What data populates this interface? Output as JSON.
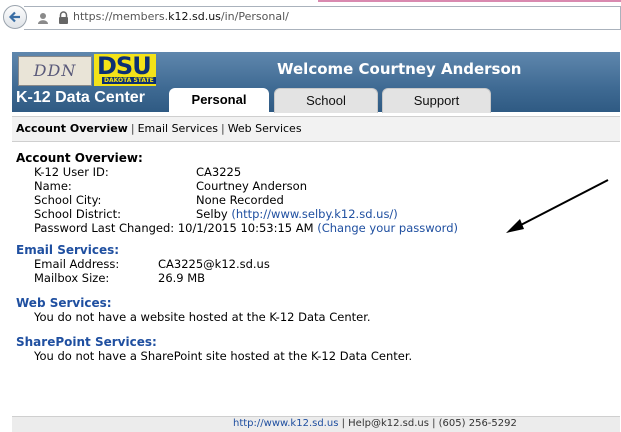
{
  "browser": {
    "url_prefix": "https://members.",
    "url_domain": "k12.sd.us",
    "url_path": "/in/Personal/"
  },
  "header": {
    "logo_ddn": "DDN",
    "logo_dsu": "DSU",
    "logo_dsu_sub": "DAKOTA STATE",
    "brand": "K-12 Data Center",
    "welcome": "Welcome Courtney Anderson",
    "tabs": [
      {
        "label": "Personal",
        "active": true
      },
      {
        "label": "School",
        "active": false
      },
      {
        "label": "Support",
        "active": false
      }
    ]
  },
  "subnav": {
    "current": "Account Overview",
    "links": [
      "Email Services",
      "Web Services"
    ],
    "separator": "|"
  },
  "account": {
    "title": "Account Overview:",
    "rows": [
      {
        "label": "K-12 User ID:",
        "value": "CA3225"
      },
      {
        "label": "Name:",
        "value": "Courtney Anderson"
      },
      {
        "label": "School City:",
        "value": "None Recorded"
      },
      {
        "label": "School District:",
        "value": "Selby",
        "link": "(http://www.selby.k12.sd.us/)"
      },
      {
        "label": "Password Last Changed:",
        "value": "10/1/2015 10:53:15 AM",
        "link": "(Change your password)"
      }
    ]
  },
  "email": {
    "title": "Email Services:",
    "rows": [
      {
        "label": "Email Address:",
        "value": "CA3225@k12.sd.us"
      },
      {
        "label": "Mailbox Size:",
        "value": "26.9 MB"
      }
    ]
  },
  "web": {
    "title": "Web Services:",
    "note": "You do not have a website hosted at the K-12 Data Center."
  },
  "sharepoint": {
    "title": "SharePoint Services:",
    "note": "You do not have a SharePoint site hosted at the K-12 Data Center."
  },
  "footer": {
    "link": "http://www.k12.sd.us",
    "rest": " | Help@k12.sd.us | (605) 256-5292"
  },
  "colors": {
    "header_blue": "#3f6a93",
    "link_blue": "#1f4fa0",
    "dsu_yellow": "#f3e218"
  }
}
